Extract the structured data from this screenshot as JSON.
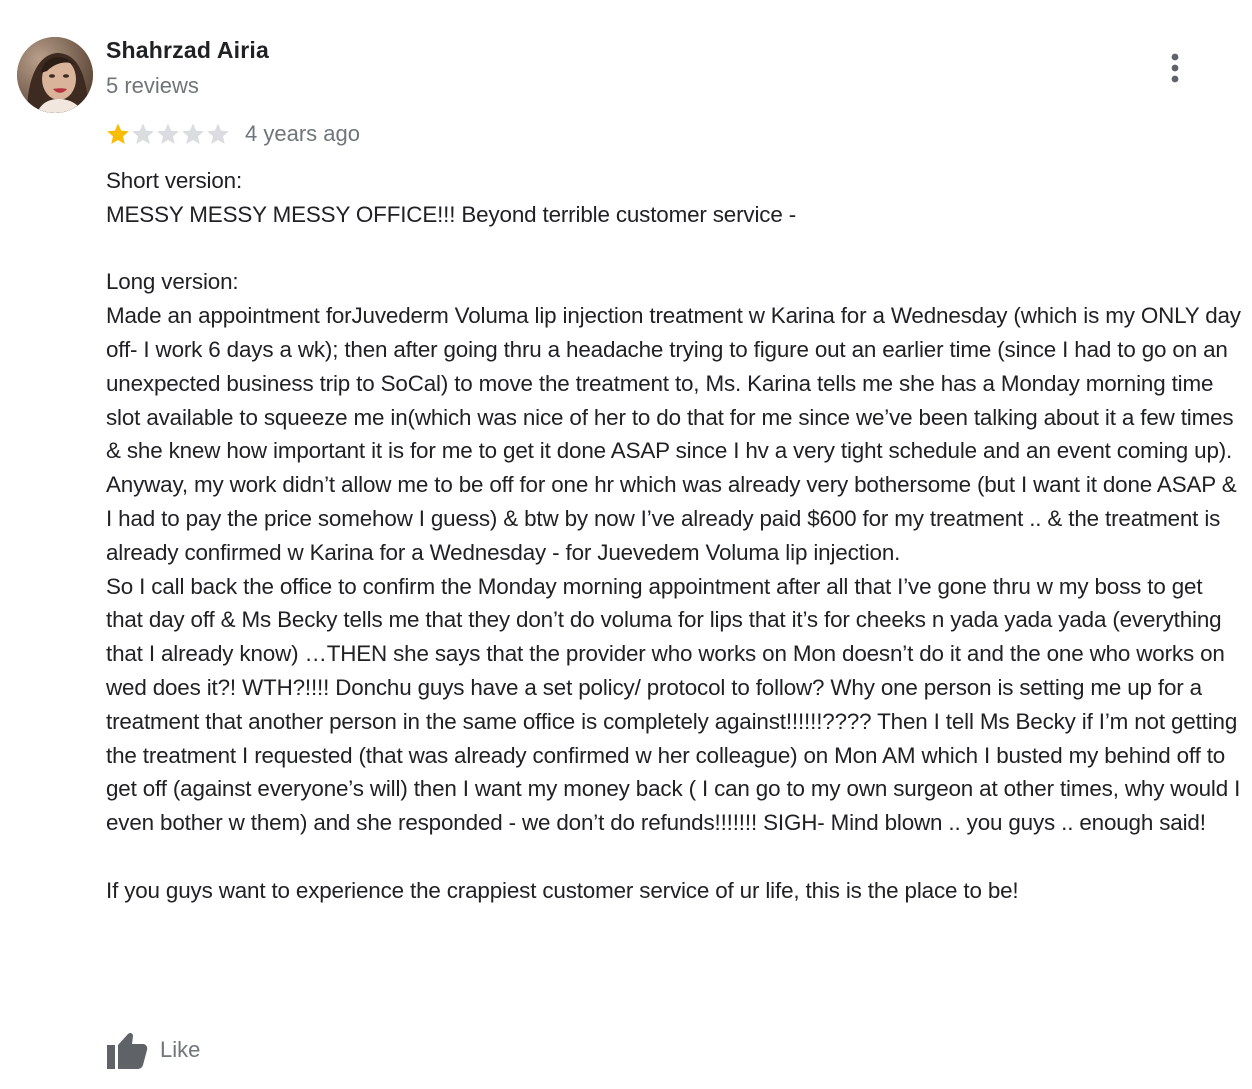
{
  "reviewer": {
    "name": "Shahrzad Airia",
    "reviews_count": "5 reviews"
  },
  "rating": {
    "value": 1,
    "max": 5,
    "filled_color": "#fbbc04",
    "empty_color": "#dadce0"
  },
  "review": {
    "date": "4 years ago",
    "text": "Short version:\nMESSY MESSY MESSY OFFICE!!! Beyond terrible customer service -\n\nLong version:\nMade an appointment forJuvederm Voluma lip injection treatment w Karina for a Wednesday (which is my ONLY day off- I work 6 days a wk); then after going thru a headache trying to figure out an earlier time (since I had to go on an unexpected business trip to SoCal) to move the treatment to, Ms. Karina tells me she has a Monday morning time slot available to squeeze me in(which was nice of her to do that for me since we’ve been talking about it a few times & she knew how important it is for me to get it done ASAP since I hv a very tight schedule and an event coming up). Anyway, my work didn’t allow me to be off for one hr which was already very bothersome (but I want it done ASAP & I had to pay the price somehow I guess) & btw by now I’ve already paid $600 for my treatment .. & the treatment is already confirmed w Karina for a Wednesday - for Juevedem Voluma lip injection.\nSo I call back the office to confirm the Monday morning appointment after all that I’ve gone thru w my boss to get that day off & Ms Becky tells me that they don’t do voluma for lips that it’s for cheeks n yada yada yada (everything that I already know) …THEN she says that the provider who works on Mon doesn’t do it and the one who works on wed does it?! WTH?!!!! Donchu guys have a set policy/ protocol to follow? Why one person is setting me up for a treatment that another person in the same office is completely against!!!!!!???? Then I tell Ms Becky if I’m not getting the treatment I requested (that was already confirmed w her colleague) on Mon AM which I busted my behind off to get off (against everyone’s will) then I want my money back ( I can go to my own surgeon at other times, why would I even bother w them) and she responded - we don’t do refunds!!!!!!! SIGH- Mind blown .. you guys .. enough said!\n\nIf you guys want to experience the crappiest customer service of ur life, this is the place to be!"
  },
  "actions": {
    "like_label": "Like",
    "like_icon": "thumbs-up-icon",
    "more_icon": "more-vert-icon"
  }
}
